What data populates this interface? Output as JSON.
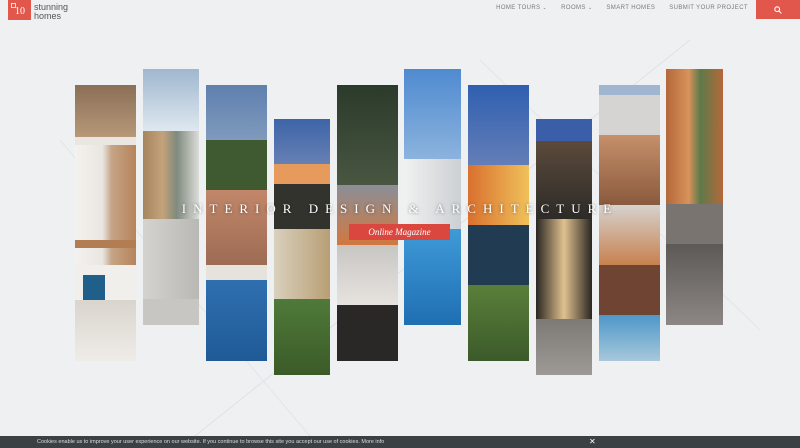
{
  "logo": {
    "number": "10",
    "line1": "stunning",
    "line2": "homes"
  },
  "nav": [
    {
      "label": "HOME TOURS",
      "dropdown": true
    },
    {
      "label": "ROOMS",
      "dropdown": true
    },
    {
      "label": "SMART HOMES",
      "dropdown": false
    },
    {
      "label": "SUBMIT YOUR PROJECT",
      "dropdown": false
    }
  ],
  "search": {
    "icon": "search-icon"
  },
  "hero": {
    "title": "INTERIOR DESIGN & ARCHITECTURE",
    "subtitle": "Online Magazine"
  },
  "cookie": {
    "text": "Cookies enable us to improve your user experience on our website. If you continue to browse this site you accept our use of cookies. More info",
    "close": "✕"
  },
  "colors": {
    "accent": "#e2574c",
    "background": "#eef0f2",
    "cookie_bar": "#3b4045"
  }
}
